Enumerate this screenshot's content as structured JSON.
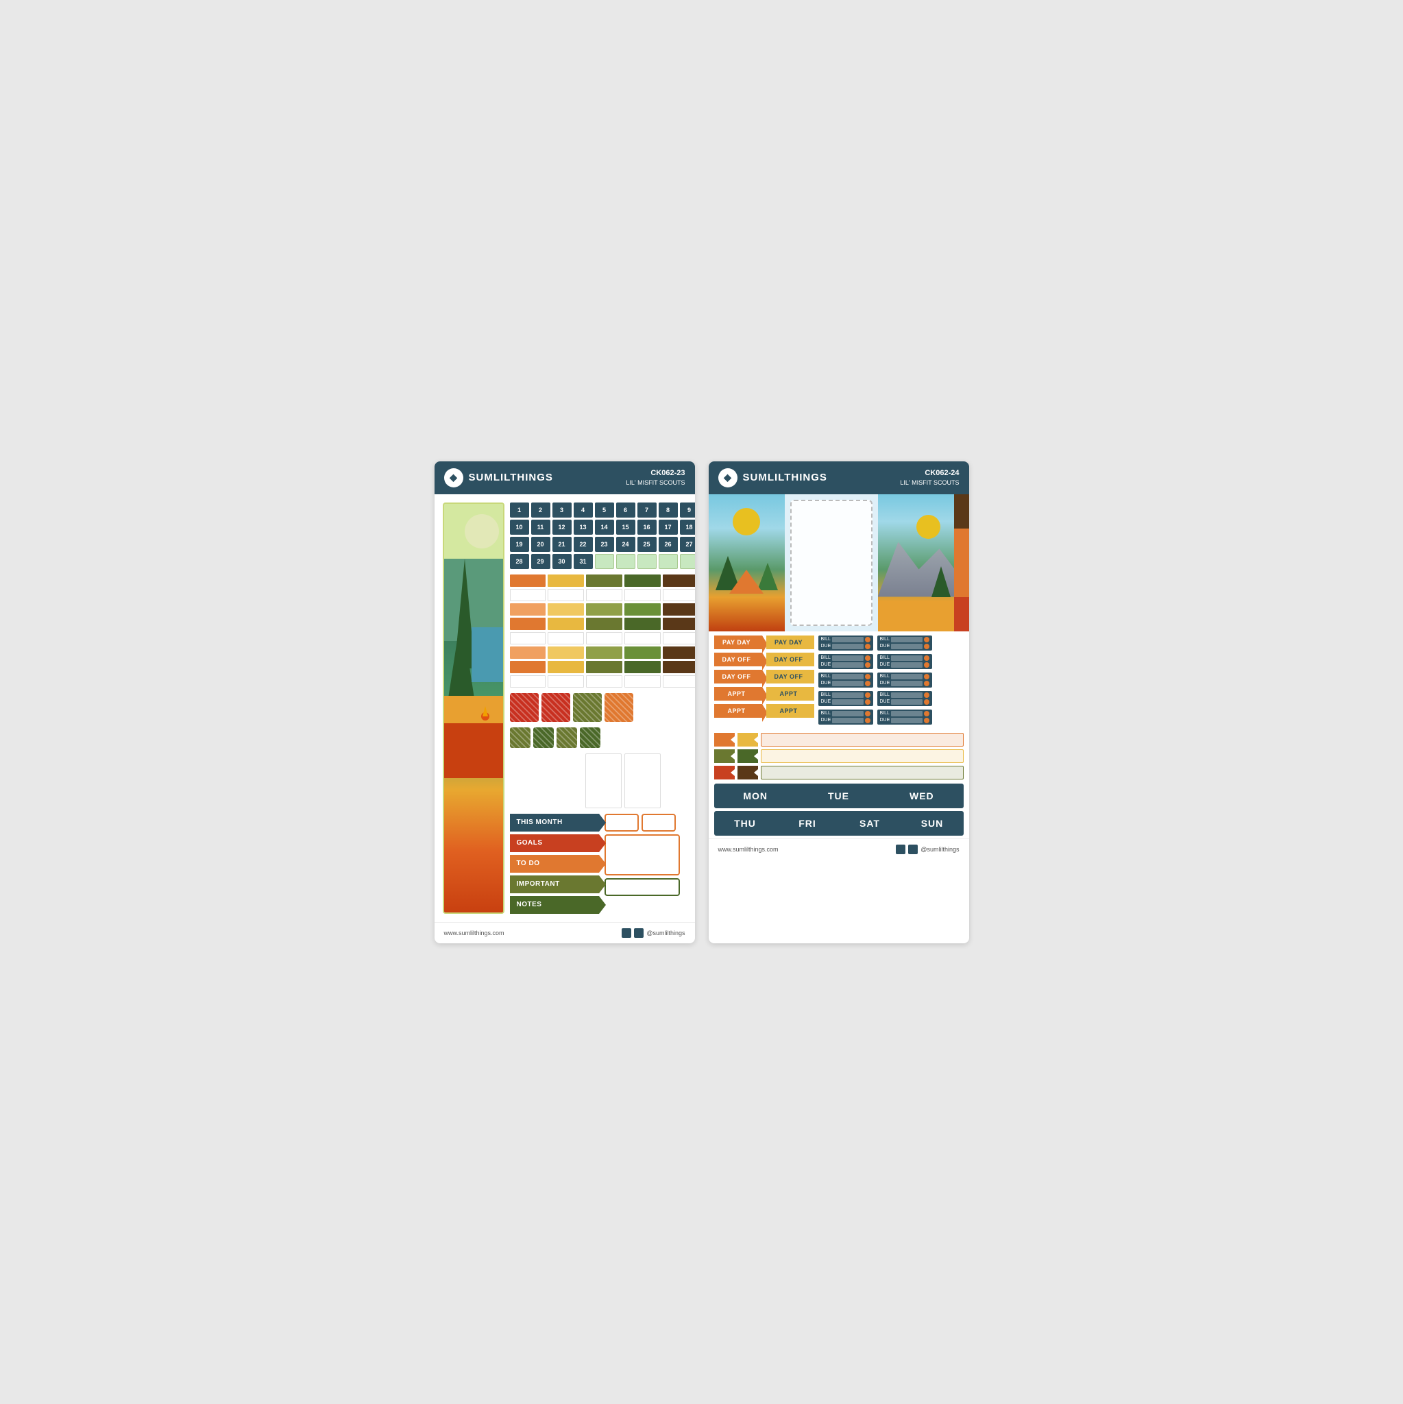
{
  "left_card": {
    "header": {
      "brand": "SUMLILTHINGS",
      "code": "CK062-23",
      "subtitle": "LIL' MISFIT SCOUTS"
    },
    "numbers": [
      [
        1,
        2,
        3,
        4,
        5,
        6,
        7,
        8,
        9
      ],
      [
        10,
        11,
        12,
        13,
        14,
        15,
        16,
        17,
        18
      ],
      [
        19,
        20,
        21,
        22,
        23,
        24,
        25,
        26,
        27
      ],
      [
        28,
        29,
        30,
        31,
        "",
        "",
        "",
        "",
        ""
      ]
    ],
    "labels": [
      {
        "text": "THIS MONTH",
        "color": "dark"
      },
      {
        "text": "GOALS",
        "color": "red"
      },
      {
        "text": "TO DO",
        "color": "orange"
      },
      {
        "text": "IMPORTANT",
        "color": "olive"
      },
      {
        "text": "NOTES",
        "color": "green"
      }
    ],
    "footer_url": "www.sumlilthings.com",
    "footer_social": "@sumlilthings"
  },
  "right_card": {
    "header": {
      "brand": "SUMLILTHINGS",
      "code": "CK062-24",
      "subtitle": "LIL' MISFIT SCOUTS"
    },
    "arrow_stickers": [
      {
        "text": "PAY DAY",
        "col": 1
      },
      {
        "text": "PAY DAY",
        "col": 2
      },
      {
        "text": "DAY OFF",
        "col": 1
      },
      {
        "text": "DAY OFF",
        "col": 2
      },
      {
        "text": "DAY OFF",
        "col": 1
      },
      {
        "text": "DAY OFF",
        "col": 2
      },
      {
        "text": "APPT",
        "col": 1
      },
      {
        "text": "APPT",
        "col": 2
      },
      {
        "text": "APPT",
        "col": 1
      },
      {
        "text": "APPT",
        "col": 2
      }
    ],
    "days_row1": [
      "MON",
      "TUE",
      "WED"
    ],
    "days_row2": [
      "THU",
      "FRI",
      "SAT",
      "SUN"
    ],
    "footer_url": "www.sumlilthings.com",
    "footer_social": "@sumlilthings"
  }
}
